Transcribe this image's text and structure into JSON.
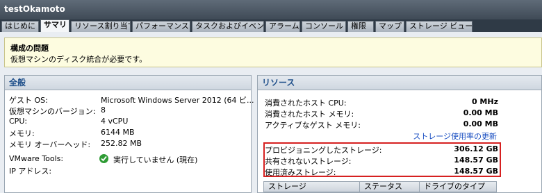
{
  "window": {
    "title": "testOkamoto"
  },
  "tabs": [
    {
      "label": "はじめに"
    },
    {
      "label": "サマリ"
    },
    {
      "label": "リソース割り当て"
    },
    {
      "label": "パフォーマンス"
    },
    {
      "label": "タスクおよびイベント"
    },
    {
      "label": "アラーム"
    },
    {
      "label": "コンソール"
    },
    {
      "label": "権限"
    },
    {
      "label": "マップ"
    },
    {
      "label": "ストレージ ビュー"
    }
  ],
  "active_tab": "サマリ",
  "alert": {
    "title": "構成の問題",
    "message": "仮想マシンのディスク統合が必要です。"
  },
  "general": {
    "header": "全般",
    "rows": [
      {
        "label": "ゲスト OS:",
        "value": "Microsoft Windows Server 2012 (64 ビ..."
      },
      {
        "label": "仮想マシンのバージョン:",
        "value": "8"
      },
      {
        "label": "CPU:",
        "value": "4 vCPU"
      },
      {
        "label": "メモリ:",
        "value": "6144 MB"
      },
      {
        "label": "メモリ オーバーヘッド:",
        "value": "252.82 MB"
      }
    ],
    "vmware_tools": {
      "label": "VMware Tools:",
      "value": "実行していません (現在)"
    },
    "ip": {
      "label": "IP アドレス:",
      "value": ""
    }
  },
  "resources": {
    "header": "リソース",
    "rows": [
      {
        "label": "消費されたホスト CPU:",
        "value": "0 MHz"
      },
      {
        "label": "消費されたホスト メモリ:",
        "value": "0.00 MB"
      },
      {
        "label": "アクティブなゲスト メモリ:",
        "value": "0.00 MB"
      }
    ],
    "refresh_link": "ストレージ使用率の更新",
    "storage_rows": [
      {
        "label": "プロビジョニングしたストレージ:",
        "value": "306.12 GB"
      },
      {
        "label": "共有されないストレージ:",
        "value": "148.57 GB"
      },
      {
        "label": "使用済みストレージ:",
        "value": "148.57 GB"
      }
    ],
    "table_columns": [
      "ストレージ",
      "ステータス",
      "ドライブのタイプ"
    ]
  },
  "colors": {
    "accent": "#1f4f8a",
    "alert_bg": "#fdfce0",
    "highlight_box": "#d62020",
    "ok_status": "#2e9b34"
  }
}
